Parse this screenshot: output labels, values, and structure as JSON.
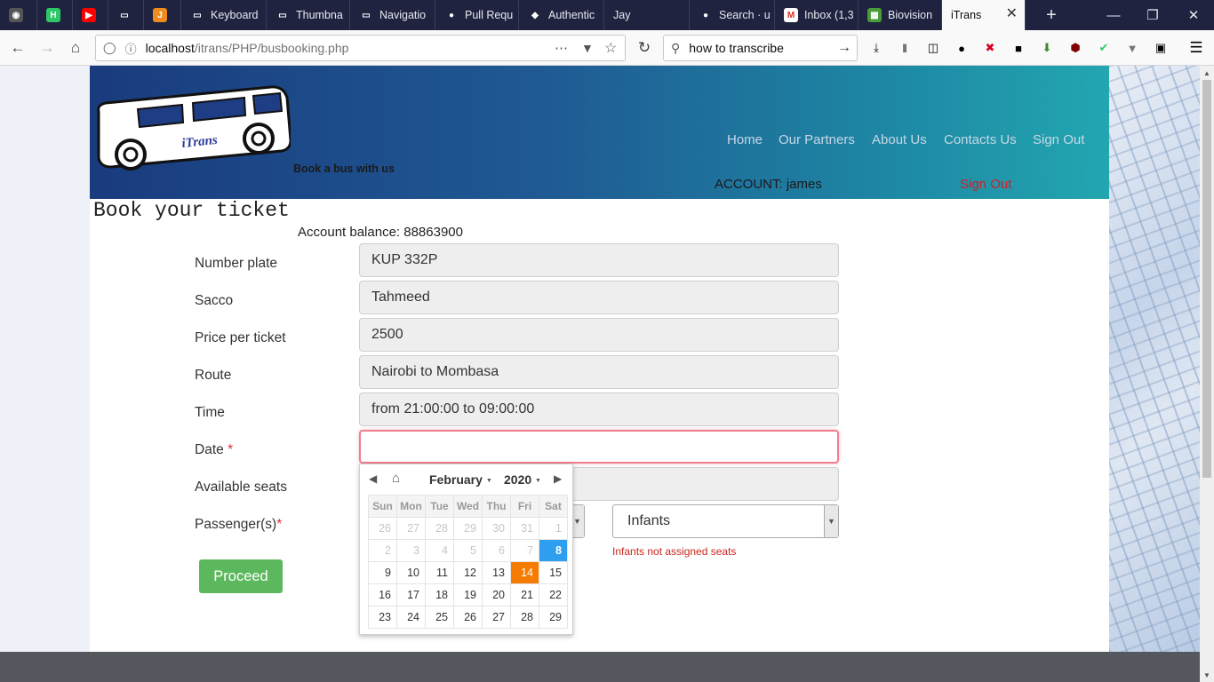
{
  "browser": {
    "tabs": [
      {
        "label": "",
        "icon": "tor-icon",
        "color": "#555555",
        "glyph": "◉"
      },
      {
        "label": "",
        "icon": "hackerrank-icon",
        "color": "#2ec866",
        "glyph": "H"
      },
      {
        "label": "",
        "icon": "youtube-icon",
        "color": "#ff0000",
        "glyph": "▶"
      },
      {
        "label": "",
        "icon": "monitor-icon",
        "color": "#202340",
        "glyph": "▭"
      },
      {
        "label": "",
        "icon": "j-icon",
        "color": "#f08c1e",
        "glyph": "J"
      },
      {
        "label": "Keyboard",
        "icon": "monitor-icon",
        "color": "#202340",
        "glyph": "▭"
      },
      {
        "label": "Thumbna",
        "icon": "monitor-icon",
        "color": "#202340",
        "glyph": "▭"
      },
      {
        "label": "Navigatio",
        "icon": "monitor-icon",
        "color": "#202340",
        "glyph": "▭"
      },
      {
        "label": "Pull Requ",
        "icon": "github-icon",
        "color": "#202340",
        "glyph": "●"
      },
      {
        "label": "Authentic",
        "icon": "laravel-icon",
        "color": "#202340",
        "glyph": "◆"
      },
      {
        "label": "Jay",
        "icon": "",
        "color": "",
        "glyph": ""
      },
      {
        "label": "Search · u",
        "icon": "github-icon",
        "color": "#202340",
        "glyph": "●"
      },
      {
        "label": "Inbox (1,3",
        "icon": "gmail-icon",
        "color": "#ffffff",
        "glyph": "M"
      },
      {
        "label": "Biovision",
        "icon": "biovision-icon",
        "color": "#4a9c3a",
        "glyph": "▦"
      },
      {
        "label": "iTrans",
        "icon": "",
        "color": "",
        "glyph": ""
      }
    ],
    "url_host": "localhost",
    "url_path": "/itrans/PHP/busbooking.php",
    "search_value": "how to transcribe",
    "new_tab": "+",
    "win_min": "—",
    "win_max": "❐",
    "win_close": "✕"
  },
  "header": {
    "logo_text": "iTrans",
    "tagline": "Book a bus with us",
    "nav": [
      "Home",
      "Our Partners",
      "About Us",
      "Contacts Us",
      "Sign Out"
    ],
    "account": "ACCOUNT: james",
    "signout": "Sign Out"
  },
  "form": {
    "title": "Book your ticket",
    "balance": "Account balance: 88863900",
    "fields": [
      {
        "label": "Number plate",
        "value": "KUP 332P"
      },
      {
        "label": "Sacco",
        "value": "Tahmeed"
      },
      {
        "label": "Price per ticket",
        "value": "2500"
      },
      {
        "label": "Route",
        "value": "Nairobi to Mombasa"
      },
      {
        "label": "Time",
        "value": "from 21:00:00 to 09:00:00"
      }
    ],
    "date_label": "Date",
    "date_value": "",
    "seats_label": "Available seats",
    "passengers_label": "Passenger(s)",
    "required_mark": "*",
    "infants_selected": "Infants",
    "infants_note": "Infants not assigned seats",
    "proceed": "Proceed"
  },
  "datepicker": {
    "month": "February",
    "year": "2020",
    "weekdays": [
      "Sun",
      "Mon",
      "Tue",
      "Wed",
      "Thu",
      "Fri",
      "Sat"
    ],
    "weeks": [
      [
        26,
        27,
        28,
        29,
        30,
        31,
        1
      ],
      [
        2,
        3,
        4,
        5,
        6,
        7,
        8
      ],
      [
        9,
        10,
        11,
        12,
        13,
        14,
        15
      ],
      [
        16,
        17,
        18,
        19,
        20,
        21,
        22
      ],
      [
        23,
        24,
        25,
        26,
        27,
        28,
        29
      ]
    ],
    "muted_days": [
      26,
      27,
      28,
      29,
      30,
      31,
      1,
      2,
      3,
      4,
      5,
      6,
      7
    ],
    "today": 8,
    "selected": 14,
    "colors": {
      "today": "#2e9fef",
      "selected": "#f57c00"
    }
  },
  "colors": {
    "proceed_button": "#5cb85c",
    "focus_border": "#f07e90",
    "required": "#d9302c",
    "header_start": "#1a3b7e",
    "header_end": "#22a6b0"
  }
}
